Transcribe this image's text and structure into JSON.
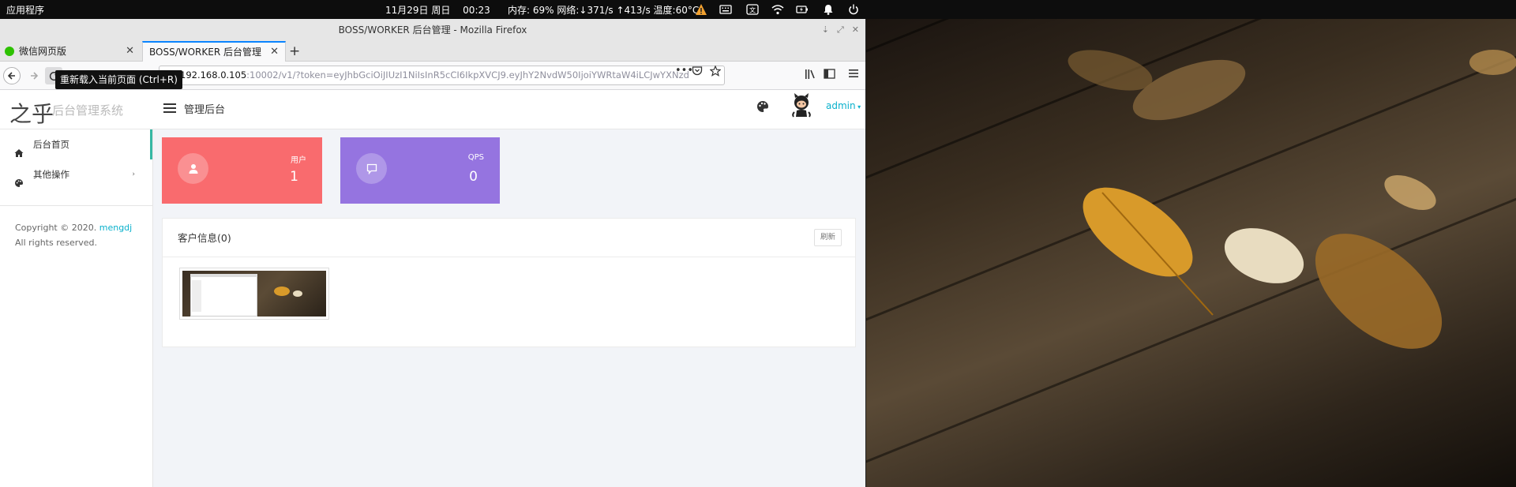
{
  "system_bar": {
    "apps_menu": "应用程序",
    "clock": "11月29日 周日　 00:23",
    "sysinfo": "内存: 69% 网络:↓371/s ↑413/s 温度:60°C",
    "tray_icons": [
      "warning-icon",
      "keyboard-icon",
      "translate-icon",
      "wifi-icon",
      "battery-icon",
      "bell-icon",
      "power-icon"
    ]
  },
  "browser": {
    "window_title": "BOSS/WORKER 后台管理 - Mozilla Firefox",
    "tabs": [
      {
        "label": "微信网页版",
        "active": false
      },
      {
        "label": "BOSS/WORKER 后台管理",
        "active": true
      }
    ],
    "url_host": "192.168.0.105",
    "url_rest": ":10002/v1/?token=eyJhbGciOiJIUzI1NiIsInR5cCI6IkpXVCJ9.eyJhY2NvdW50IjoiYWRtaW4iLCJwYXNzd",
    "tooltip": "重新载入当前页面 (Ctrl+R)"
  },
  "app": {
    "logo_text": "之乎",
    "logo_subtitle": "后台管理系统",
    "header_title": "管理后台",
    "user_name": "admin",
    "sidebar": [
      {
        "label": "后台首页",
        "icon": "home-icon",
        "active": true
      },
      {
        "label": "其他操作",
        "icon": "palette-icon",
        "active": false
      }
    ],
    "copyright_prefix": "Copyright © 2020.",
    "copyright_link": "mengdj",
    "copyright_suffix": "All rights reserved.",
    "stats": [
      {
        "label": "用户",
        "value": "1",
        "icon": "user-icon",
        "color": "#f96b6e"
      },
      {
        "label": "QPS",
        "value": "0",
        "icon": "chat-icon",
        "color": "#9574e0"
      }
    ],
    "panel_title": "客户信息(0)",
    "refresh_label": "刷新"
  },
  "colors": {
    "accent": "#0ab1cc",
    "active_indicator": "#35b8a4",
    "tab_highlight": "#0a84ff"
  }
}
